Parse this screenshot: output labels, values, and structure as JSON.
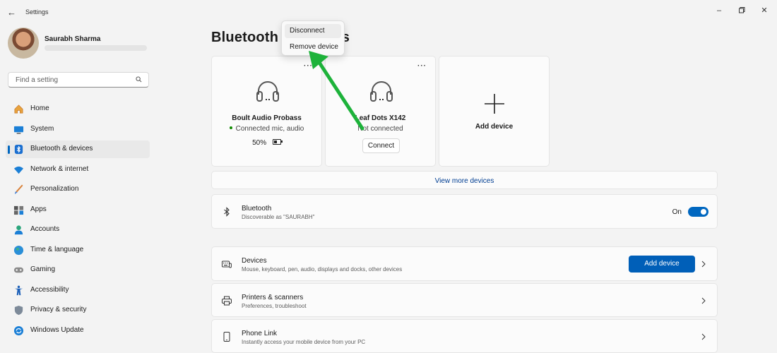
{
  "window": {
    "title": "Settings",
    "controls": [
      "minimize",
      "maximize",
      "close"
    ]
  },
  "profile": {
    "name": "Saurabh Sharma"
  },
  "search": {
    "placeholder": "Find a setting"
  },
  "sidebar": {
    "items": [
      {
        "label": "Home",
        "icon": "home-icon"
      },
      {
        "label": "System",
        "icon": "system-icon"
      },
      {
        "label": "Bluetooth & devices",
        "icon": "bluetooth-icon",
        "active": true
      },
      {
        "label": "Network & internet",
        "icon": "wifi-icon"
      },
      {
        "label": "Personalization",
        "icon": "brush-icon"
      },
      {
        "label": "Apps",
        "icon": "apps-icon"
      },
      {
        "label": "Accounts",
        "icon": "account-icon"
      },
      {
        "label": "Time & language",
        "icon": "globe-icon"
      },
      {
        "label": "Gaming",
        "icon": "gamepad-icon"
      },
      {
        "label": "Accessibility",
        "icon": "accessibility-icon"
      },
      {
        "label": "Privacy & security",
        "icon": "shield-icon"
      },
      {
        "label": "Windows Update",
        "icon": "update-icon"
      }
    ]
  },
  "page": {
    "title": "Bluetooth & devices"
  },
  "devices": [
    {
      "name": "Boult Audio Probass",
      "status": "Connected mic, audio",
      "battery": "50%",
      "battery_level": 0.5,
      "more": "···"
    },
    {
      "name": "Leaf Dots X142",
      "status": "Not connected",
      "action": "Connect",
      "more": "···"
    }
  ],
  "add_device_card": {
    "label": "Add device"
  },
  "view_more": {
    "label": "View more devices"
  },
  "bluetooth_row": {
    "title": "Bluetooth",
    "subtitle": "Discoverable as \"SAURABH\"",
    "toggle_label": "On",
    "toggle_on": true
  },
  "settings_rows": [
    {
      "title": "Devices",
      "subtitle": "Mouse, keyboard, pen, audio, displays and docks, other devices",
      "button": "Add device",
      "icon": "keyboard-mouse-icon"
    },
    {
      "title": "Printers & scanners",
      "subtitle": "Preferences, troubleshoot",
      "icon": "printer-icon"
    },
    {
      "title": "Phone Link",
      "subtitle": "Instantly access your mobile device from your PC",
      "icon": "phone-icon"
    }
  ],
  "context_menu": {
    "items": [
      "Disconnect",
      "Remove device"
    ]
  },
  "colors": {
    "accent": "#0067c0",
    "annotation_arrow": "#1db23a",
    "connected_dot": "#108a00"
  }
}
